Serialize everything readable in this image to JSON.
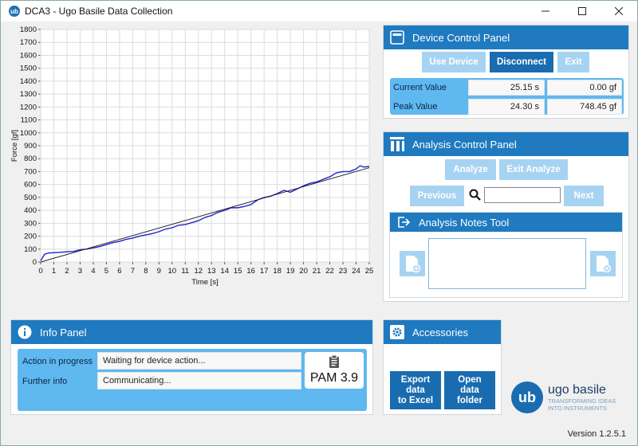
{
  "window": {
    "title": "DCA3 - Ugo Basile Data Collection",
    "app_icon": "ub",
    "controls": [
      "minimize-icon",
      "maximize-icon",
      "close-icon"
    ]
  },
  "chart_data": {
    "type": "line",
    "xlabel": "Time [s]",
    "ylabel": "Force [gf]",
    "xlim": [
      0,
      25
    ],
    "ylim": [
      0,
      1800
    ],
    "x_ticks": [
      0,
      1,
      2,
      3,
      4,
      5,
      6,
      7,
      8,
      9,
      10,
      11,
      12,
      13,
      14,
      15,
      16,
      17,
      18,
      19,
      20,
      21,
      22,
      23,
      24,
      25
    ],
    "y_ticks": [
      0,
      100,
      200,
      300,
      400,
      500,
      600,
      700,
      800,
      900,
      1000,
      1100,
      1200,
      1300,
      1400,
      1500,
      1600,
      1700,
      1800
    ],
    "grid": true,
    "series": [
      {
        "color": "#2222cc",
        "x": [
          0,
          0.3,
          0.6,
          1,
          1.5,
          2,
          2.5,
          3,
          3.5,
          4,
          4.5,
          5,
          5.5,
          6,
          6.5,
          7,
          7.5,
          8,
          8.5,
          9,
          9.5,
          10,
          10.5,
          11,
          11.5,
          12,
          12.5,
          13,
          13.5,
          14,
          14.5,
          15,
          15.5,
          16,
          16.5,
          17,
          17.5,
          18,
          18.5,
          19,
          19.5,
          20,
          20.5,
          21,
          21.5,
          22,
          22.5,
          23,
          23.5,
          24,
          24.3,
          24.6,
          25
        ],
        "y": [
          10,
          60,
          70,
          72,
          75,
          80,
          82,
          95,
          100,
          110,
          120,
          135,
          150,
          160,
          175,
          185,
          200,
          210,
          220,
          235,
          255,
          265,
          285,
          290,
          305,
          320,
          345,
          360,
          385,
          400,
          420,
          420,
          430,
          445,
          480,
          500,
          510,
          530,
          555,
          540,
          565,
          590,
          610,
          620,
          640,
          660,
          690,
          700,
          700,
          720,
          745,
          735,
          740
        ]
      },
      {
        "color": "#222222",
        "x": [
          0,
          25
        ],
        "y": [
          0,
          730
        ]
      }
    ]
  },
  "device_panel": {
    "title": "Device Control Panel",
    "icon": "panel-icon",
    "buttons": {
      "use_device": "Use Device",
      "disconnect": "Disconnect",
      "exit": "Exit"
    },
    "current_value_label": "Current Value",
    "peak_value_label": "Peak Value",
    "current_time": "25.15 s",
    "current_force": "0.00 gf",
    "peak_time": "24.30 s",
    "peak_force": "748.45 gf"
  },
  "analysis_panel": {
    "title": "Analysis Control Panel",
    "icon": "chart-bars-icon",
    "buttons": {
      "analyze": "Analyze",
      "exit_analyze": "Exit Analyze",
      "previous": "Previous",
      "next": "Next"
    },
    "search_value": ""
  },
  "notes_tool": {
    "title": "Analysis Notes Tool",
    "icon": "export-icon",
    "notes_value": ""
  },
  "info_panel": {
    "title": "Info Panel",
    "icon": "info-icon",
    "action_label": "Action in progress",
    "action_value": "Waiting for device action...",
    "further_label": "Further info",
    "further_value": "Communicating...",
    "pam": "PAM 3.9"
  },
  "accessories": {
    "title": "Accessories",
    "icon": "gear-icon",
    "export_btn": "Export\ndata\nto Excel",
    "open_btn": "Open\ndata\nfolder"
  },
  "branding": {
    "logo_letters": "ub",
    "name": "ugo basile",
    "tagline_1": "TRANSFORMING IDEAS",
    "tagline_2": "INTO INSTRUMENTS",
    "version": "Version 1.2.5.1"
  }
}
